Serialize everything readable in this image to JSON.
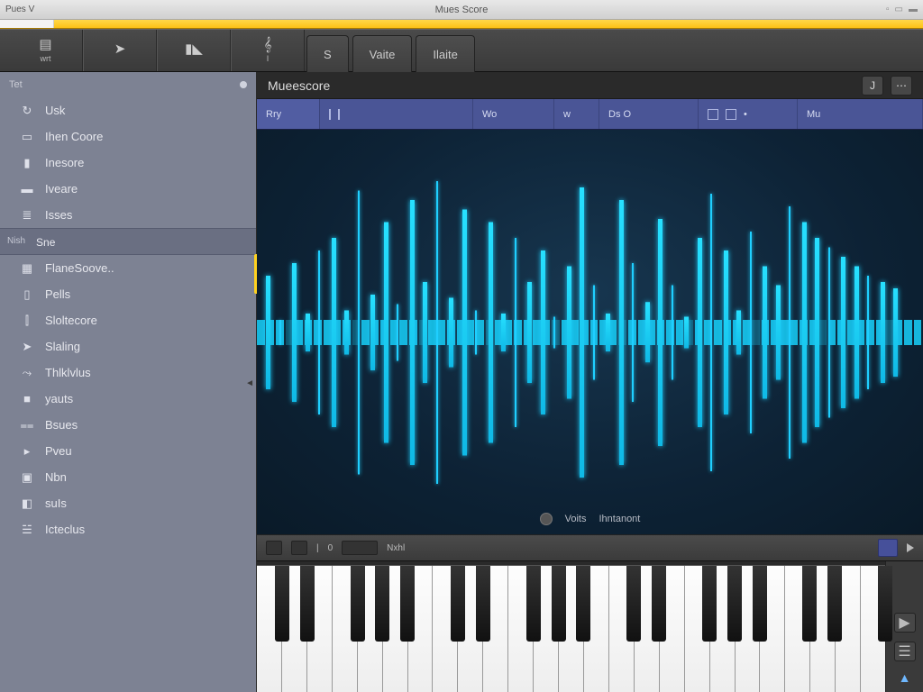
{
  "window": {
    "title": "Mues Score",
    "left_label": "Pues V",
    "right_icons": [
      "□",
      "▣",
      "▤"
    ]
  },
  "toolbar": {
    "buttons": [
      {
        "name": "new-icon",
        "label": "wrt"
      },
      {
        "name": "play-arrow-icon",
        "label": ""
      },
      {
        "name": "folder-icon",
        "label": ""
      },
      {
        "name": "note-icon",
        "label": "I"
      }
    ],
    "tabs": [
      "S",
      "Vaite",
      "Ilaite"
    ]
  },
  "sidebar": {
    "header": "Tet",
    "group1": [
      {
        "icon": "refresh-icon",
        "label": "Usk"
      },
      {
        "icon": "panel-icon",
        "label": "Ihen Coore"
      },
      {
        "icon": "bookmark-icon",
        "label": "Inesore"
      },
      {
        "icon": "folder-icon",
        "label": "Iveare"
      },
      {
        "icon": "list-icon",
        "label": "Isses"
      }
    ],
    "group_label_small": "Nish",
    "group_label": "Sne",
    "group2": [
      {
        "icon": "grid-icon",
        "label": "FlaneSoove.."
      },
      {
        "icon": "doc-icon",
        "label": "Pells"
      },
      {
        "icon": "bars-icon",
        "label": "Sloltecore"
      },
      {
        "icon": "send-icon",
        "label": "Slaling"
      },
      {
        "icon": "step-icon",
        "label": "Thlklvlus"
      },
      {
        "icon": "square-icon",
        "label": "yauts"
      },
      {
        "icon": "equals-icon",
        "label": "Bsues"
      },
      {
        "icon": "flag-icon",
        "label": "Pveu"
      },
      {
        "icon": "save-icon",
        "label": "Nbn"
      },
      {
        "icon": "tag-icon",
        "label": "suIs"
      },
      {
        "icon": "layers-icon",
        "label": "Icteclus"
      }
    ]
  },
  "main": {
    "title": "Mueescore",
    "head_btn": "J",
    "ruler": {
      "first": "Rry",
      "cells": [
        {
          "label": "",
          "ticks": 2
        },
        {
          "label": "Wo",
          "ticks": 0
        },
        {
          "label": "w",
          "ticks": 0
        },
        {
          "label": "Ds   O",
          "ticks": 0
        },
        {
          "label": "",
          "icons": true
        },
        {
          "label": "Mu",
          "ticks": 0
        }
      ]
    },
    "wave_footer": {
      "a": "Voits",
      "b": "Ihntanont"
    },
    "transport": {
      "value": "0",
      "label": "Nxhl"
    }
  },
  "colors": {
    "accent": "#1fd0ff",
    "ruler": "#4a5596",
    "sidebar": "#7d8293"
  },
  "piano": {
    "white_count": 25
  }
}
